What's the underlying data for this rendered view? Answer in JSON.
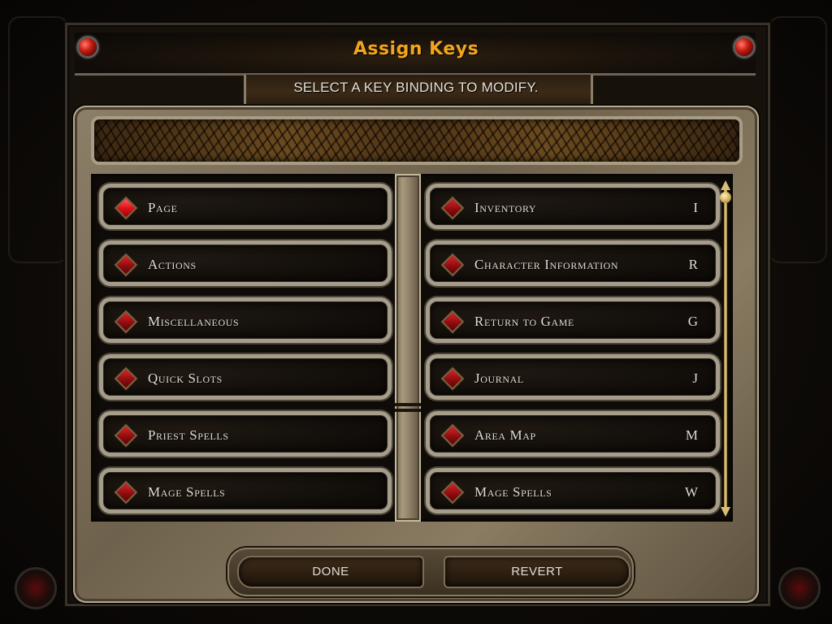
{
  "window": {
    "title": "Assign Keys",
    "subtitle": "SELECT A KEY BINDING TO MODIFY."
  },
  "description_box": {
    "text": ""
  },
  "categories": [
    {
      "label": "Page",
      "selected": true
    },
    {
      "label": "Actions",
      "selected": false
    },
    {
      "label": "Miscellaneous",
      "selected": false
    },
    {
      "label": "Quick Slots",
      "selected": false
    },
    {
      "label": "Priest Spells",
      "selected": false
    },
    {
      "label": "Mage Spells",
      "selected": false
    }
  ],
  "bindings": [
    {
      "label": "Inventory",
      "key": "I"
    },
    {
      "label": "Character Information",
      "key": "R"
    },
    {
      "label": "Return to Game",
      "key": "G"
    },
    {
      "label": "Journal",
      "key": "J"
    },
    {
      "label": "Area Map",
      "key": "M"
    },
    {
      "label": "Mage Spells",
      "key": "W"
    }
  ],
  "scrollbar": {
    "position": 0
  },
  "buttons": {
    "done": "DONE",
    "revert": "REVERT"
  },
  "colors": {
    "title": "#f2a51c",
    "text": "#e2ddd2",
    "gem": "#d8252a",
    "stone": "#a59c8a"
  },
  "icons": {
    "bullet": "red-diamond-gem-icon",
    "corner": "red-gem-ornament-icon",
    "scroll_up": "arrow-up-icon",
    "scroll_down": "arrow-down-icon"
  }
}
